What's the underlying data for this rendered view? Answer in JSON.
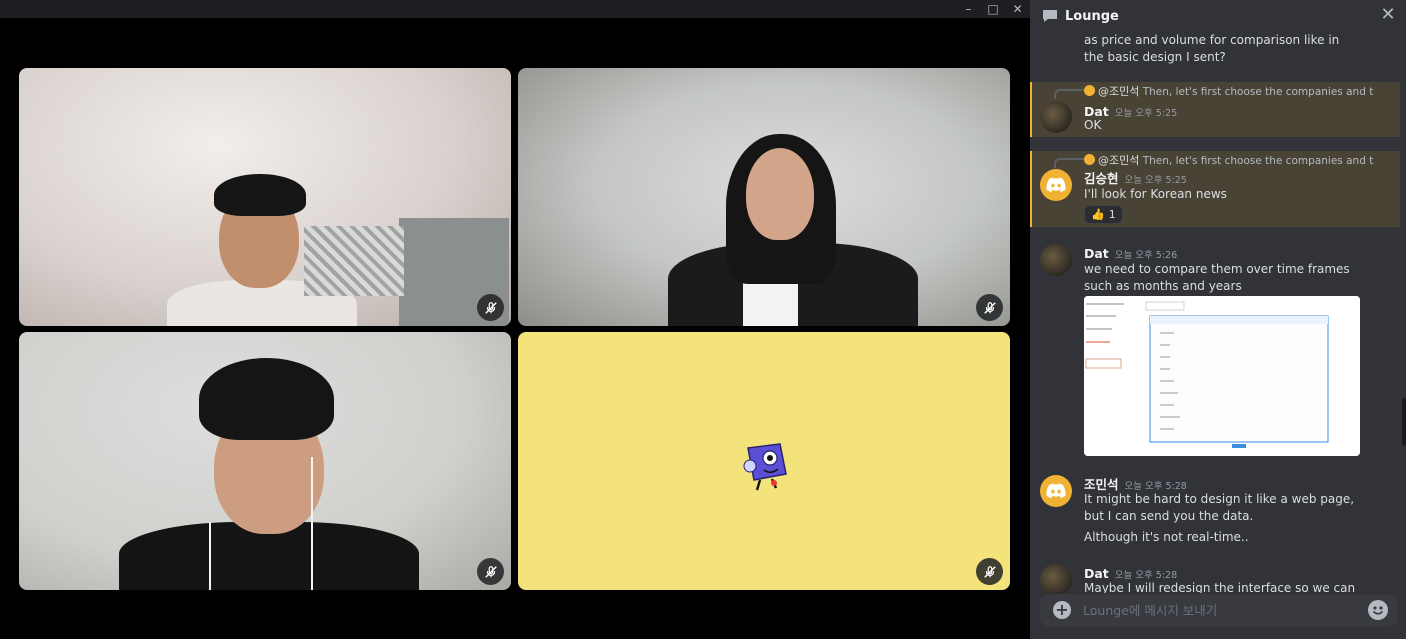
{
  "window": {
    "minimize_icon": "–",
    "maximize_icon": "□",
    "close_icon": "✕"
  },
  "chat": {
    "channel_title": "Lounge",
    "close_icon": "✕",
    "messages": [
      {
        "text": "as price and volume for comparison like in the basic design I sent?"
      },
      {
        "reply_user": "@조민석",
        "reply_text": "Then, let's first choose the companies and th",
        "author": "Dat",
        "timestamp": "오늘 오후 5:25",
        "text": "OK",
        "highlighted": true
      },
      {
        "reply_user": "@조민석",
        "reply_text": "Then, let's first choose the companies and th",
        "author": "김승현",
        "timestamp": "오늘 오후 5:25",
        "text": "I'll look for Korean news",
        "reaction_emoji": "👍",
        "reaction_count": "1",
        "highlighted": true
      },
      {
        "author": "Dat",
        "timestamp": "오늘 오후 5:26",
        "text": "we need to compare them over time frames such as months and years"
      },
      {
        "author": "조민석",
        "timestamp": "오늘 오후 5:28",
        "text": "It might be hard to design it like a web page, but I can send you the data.",
        "text2": "Although it's not real-time.."
      },
      {
        "author": "Dat",
        "timestamp": "오늘 오후 5:28",
        "text": "Maybe I will redesign the interface so we can"
      }
    ],
    "composer_placeholder": "Lounge에 메시지 보내기"
  },
  "colors": {
    "chat_bg": "#313338",
    "mention_highlight": "#494336",
    "mention_border": "#f0b232",
    "tile4_bg": "#f3e37a"
  }
}
